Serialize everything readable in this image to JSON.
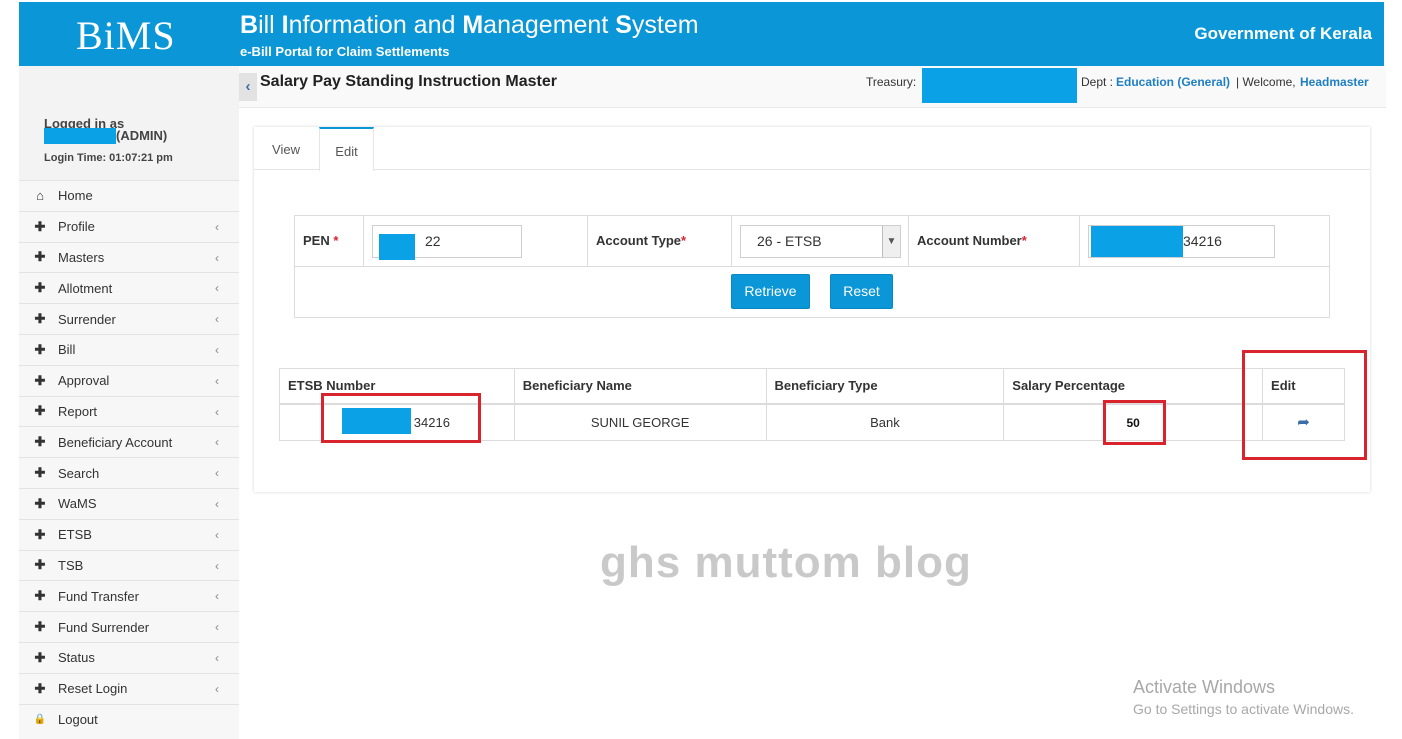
{
  "header": {
    "logo": "BiMS",
    "title_parts": [
      "B",
      "ill ",
      "I",
      "nformation and ",
      "M",
      "anagement ",
      "S",
      "ystem"
    ],
    "subtitle": "e-Bill Portal for Claim Settlements",
    "government": "Government of Kerala"
  },
  "user": {
    "logged_in_label": "Logged in as",
    "role": "(ADMIN)",
    "login_time": "Login Time: 01:07:21 pm"
  },
  "sidebar": {
    "items": [
      {
        "label": "Home",
        "icon": "home-icon",
        "glyph": "⌂",
        "chevron": false
      },
      {
        "label": "Profile",
        "icon": "plus-icon",
        "glyph": "✚",
        "chevron": true
      },
      {
        "label": "Masters",
        "icon": "plus-icon",
        "glyph": "✚",
        "chevron": true
      },
      {
        "label": "Allotment",
        "icon": "plus-icon",
        "glyph": "✚",
        "chevron": true
      },
      {
        "label": "Surrender",
        "icon": "plus-icon",
        "glyph": "✚",
        "chevron": true
      },
      {
        "label": "Bill",
        "icon": "plus-icon",
        "glyph": "✚",
        "chevron": true
      },
      {
        "label": "Approval",
        "icon": "plus-icon",
        "glyph": "✚",
        "chevron": true
      },
      {
        "label": "Report",
        "icon": "plus-icon",
        "glyph": "✚",
        "chevron": true
      },
      {
        "label": "Beneficiary Account",
        "icon": "plus-icon",
        "glyph": "✚",
        "chevron": true
      },
      {
        "label": "Search",
        "icon": "plus-icon",
        "glyph": "✚",
        "chevron": true
      },
      {
        "label": "WaMS",
        "icon": "plus-icon",
        "glyph": "✚",
        "chevron": true
      },
      {
        "label": "ETSB",
        "icon": "plus-icon",
        "glyph": "✚",
        "chevron": true
      },
      {
        "label": "TSB",
        "icon": "plus-icon",
        "glyph": "✚",
        "chevron": true
      },
      {
        "label": "Fund Transfer",
        "icon": "plus-icon",
        "glyph": "✚",
        "chevron": true
      },
      {
        "label": "Fund Surrender",
        "icon": "plus-icon",
        "glyph": "✚",
        "chevron": true
      },
      {
        "label": "Status",
        "icon": "plus-icon",
        "glyph": "✚",
        "chevron": true
      },
      {
        "label": "Reset Login",
        "icon": "plus-icon",
        "glyph": "✚",
        "chevron": true
      },
      {
        "label": "Logout",
        "icon": "lock-icon",
        "glyph": "🔒",
        "chevron": false
      }
    ]
  },
  "topbar": {
    "page_title": "Salary Pay Standing Instruction Master",
    "treasury_label": "Treasury:",
    "dept_label": "Dept :",
    "dept_value": "Education (General)",
    "welcome_label": "| Welcome,",
    "welcome_value": "Headmaster"
  },
  "tabs": [
    {
      "label": "View",
      "active": false
    },
    {
      "label": "Edit",
      "active": true
    }
  ],
  "form": {
    "pen_label": "PEN",
    "pen_value_visible": "22",
    "account_type_label": "Account Type",
    "account_type_value": "26 - ETSB",
    "account_number_label": "Account Number",
    "account_number_visible": "34216",
    "required_mark": "*",
    "retrieve_label": "Retrieve",
    "reset_label": "Reset"
  },
  "table": {
    "headers": [
      "ETSB Number",
      "Beneficiary Name",
      "Beneficiary Type",
      "Salary Percentage",
      "Edit"
    ],
    "rows": [
      {
        "etsb_visible": "34216",
        "name": "SUNIL GEORGE",
        "type": "Bank",
        "percentage": "50"
      }
    ]
  },
  "watermark": "ghs muttom blog",
  "windows_notice": {
    "title": "Activate Windows",
    "subtitle": "Go to Settings to activate Windows."
  },
  "colors": {
    "brand": "#0a96d7",
    "mask": "#0aa1e6",
    "highlight": "#d9232d",
    "link": "#1f7fc4"
  }
}
